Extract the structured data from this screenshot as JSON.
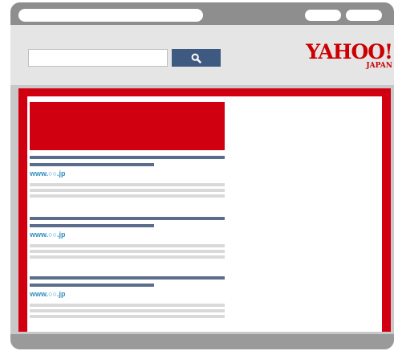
{
  "search": {
    "value": ""
  },
  "logo": {
    "main": "YAHOO!",
    "sub": "JAPAN"
  },
  "results": [
    {
      "url": "www.○○.jp"
    },
    {
      "url": "www.○○.jp"
    },
    {
      "url": "www.○○.jp"
    }
  ],
  "colors": {
    "brand_red": "#d10011",
    "search_button": "#3f5a80",
    "title_placeholder": "#5a6d8d",
    "url_text": "#2f8fbf"
  }
}
